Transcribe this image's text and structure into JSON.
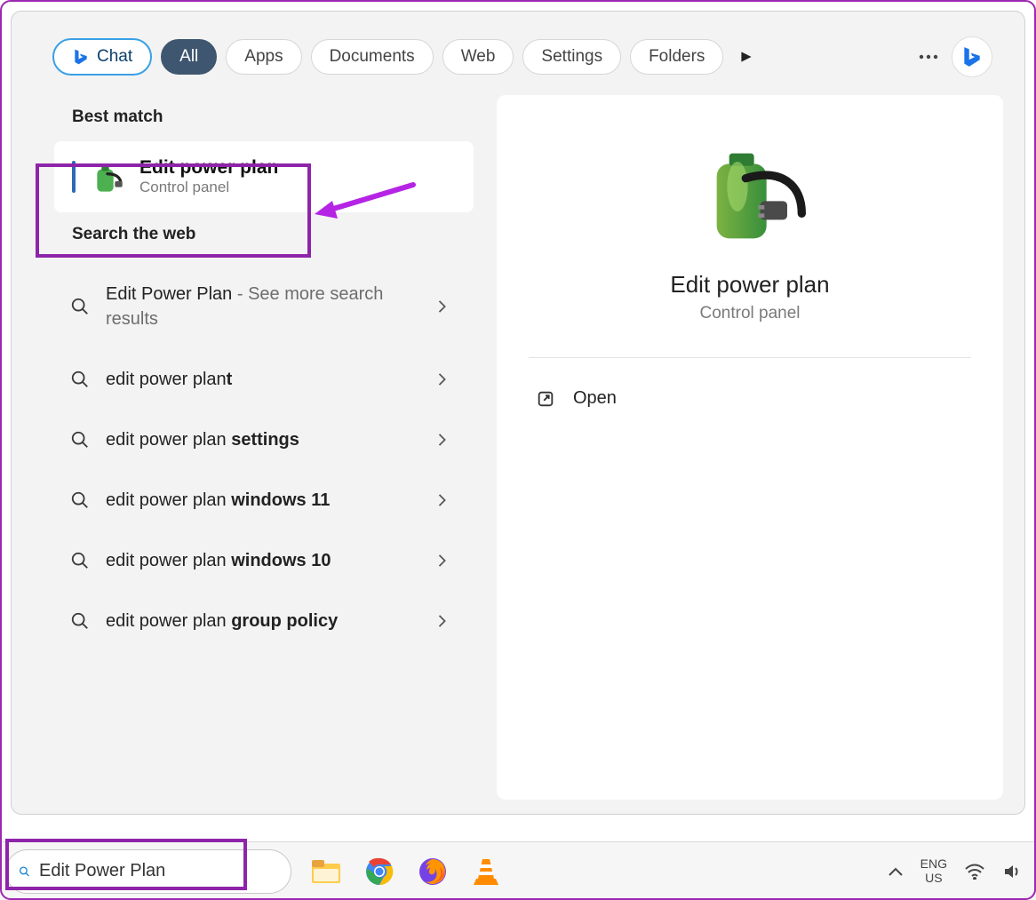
{
  "filter_tabs": {
    "chat": "Chat",
    "all": "All",
    "apps": "Apps",
    "documents": "Documents",
    "web": "Web",
    "settings": "Settings",
    "folders": "Folders"
  },
  "sections": {
    "best_match": "Best match",
    "search_web": "Search the web"
  },
  "best_match": {
    "title": "Edit power plan",
    "subtitle": "Control panel"
  },
  "web_results": [
    {
      "prefix": "Edit Power Plan",
      "suffix_light": " - See more search results"
    },
    {
      "prefix": "edit power plan",
      "bold": "t"
    },
    {
      "prefix": "edit power plan ",
      "bold": "settings"
    },
    {
      "prefix": "edit power plan ",
      "bold": "windows 11"
    },
    {
      "prefix": "edit power plan ",
      "bold": "windows 10"
    },
    {
      "prefix": "edit power plan ",
      "bold": "group policy"
    }
  ],
  "detail": {
    "title": "Edit power plan",
    "subtitle": "Control panel",
    "open": "Open"
  },
  "taskbar": {
    "search_value": "Edit Power Plan",
    "lang_line1": "ENG",
    "lang_line2": "US"
  },
  "icons": {
    "bing": "bing-icon",
    "search": "search-icon",
    "chevron": "chevron-right-icon",
    "play": "play-icon",
    "more": "more-icon",
    "open_external": "open-external-icon",
    "battery": "battery-plug-icon",
    "folder": "file-explorer-icon",
    "chrome": "chrome-icon",
    "firefox": "firefox-icon",
    "vlc": "vlc-icon",
    "wifi": "wifi-icon",
    "speaker": "speaker-icon",
    "tray_chevron": "chevron-up-icon"
  }
}
